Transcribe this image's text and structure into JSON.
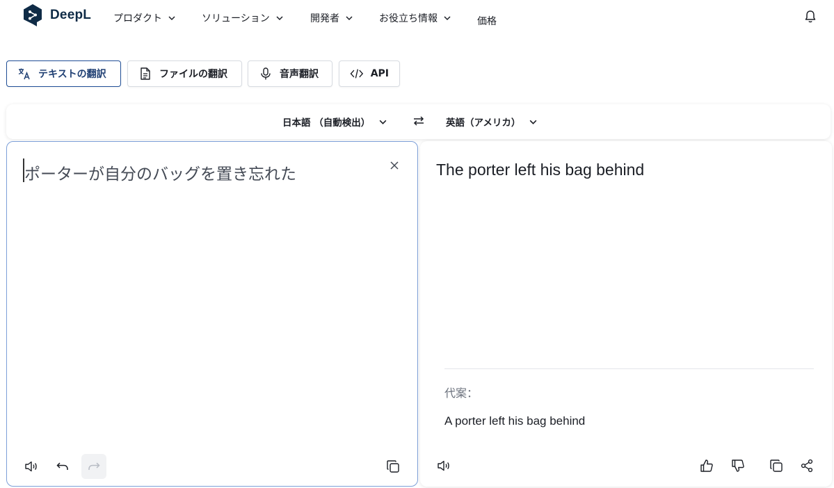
{
  "header": {
    "brand": "DeepL",
    "nav": [
      {
        "label": "プロダクト",
        "has_dropdown": true
      },
      {
        "label": "ソリューション",
        "has_dropdown": true
      },
      {
        "label": "開発者",
        "has_dropdown": true
      },
      {
        "label": "お役立ち情報",
        "has_dropdown": true
      },
      {
        "label": "価格",
        "has_dropdown": false
      }
    ],
    "notification_icon": "bell-icon"
  },
  "modes": [
    {
      "label": "テキストの翻訳",
      "icon": "translate-icon",
      "active": true
    },
    {
      "label": "ファイルの翻訳",
      "icon": "document-icon",
      "active": false
    },
    {
      "label": "音声翻訳",
      "icon": "microphone-icon",
      "active": false
    },
    {
      "label": "API",
      "icon": "code-icon",
      "active": false
    }
  ],
  "languages": {
    "source": "日本語 （自動検出）",
    "target": "英語（アメリカ）",
    "swap_icon": "swap-icon"
  },
  "source_panel": {
    "text": "ポーターが自分のバッグを置き忘れた",
    "toolbar": [
      "speaker-icon",
      "undo-icon",
      "redo-icon",
      "copy-icon"
    ]
  },
  "target_panel": {
    "text": "The porter left his bag behind",
    "alternatives_label": "代案：",
    "alternatives": [
      "A porter left his bag behind"
    ],
    "toolbar": [
      "speaker-icon",
      "thumbs-up-icon",
      "thumbs-down-icon",
      "copy-icon",
      "share-icon"
    ]
  },
  "colors": {
    "brand": "#0f2b46",
    "active_border": "#1f4e96",
    "source_border": "#7c9fd8"
  }
}
